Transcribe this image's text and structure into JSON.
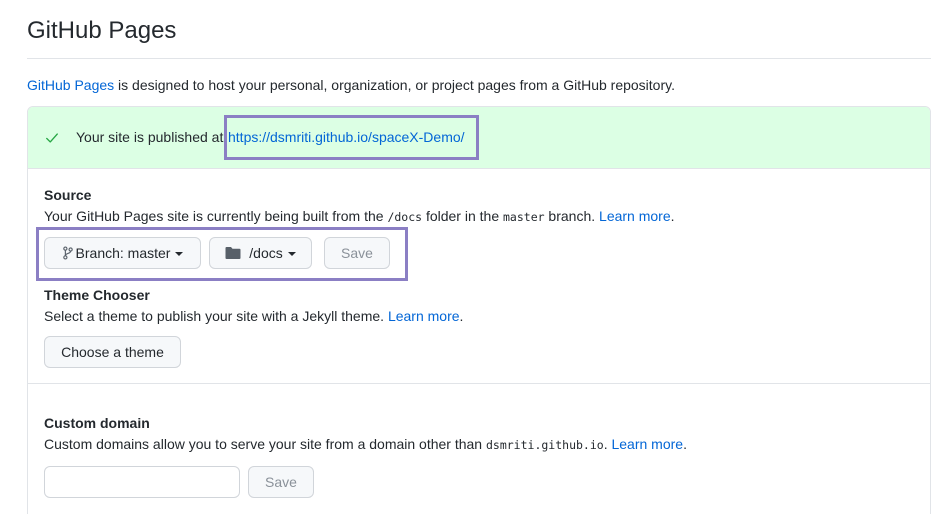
{
  "page": {
    "title": "GitHub Pages"
  },
  "intro": {
    "link_text": "GitHub Pages",
    "text": " is designed to host your personal, organization, or project pages from a GitHub repository."
  },
  "published": {
    "text": "Your site is published at ",
    "url": "https://dsmriti.github.io/spaceX-Demo/",
    "icon": "check-icon"
  },
  "source": {
    "heading": "Source",
    "desc_prefix": "Your GitHub Pages site is currently being built from the ",
    "folder_code": "/docs",
    "desc_middle": " folder in the ",
    "branch_code": "master",
    "desc_suffix": " branch. ",
    "learn_more": "Learn more",
    "desc_end": ".",
    "branch_button": "Branch: master",
    "folder_button": "/docs",
    "save_button": "Save"
  },
  "theme": {
    "heading": "Theme Chooser",
    "desc": "Select a theme to publish your site with a Jekyll theme. ",
    "learn_more": "Learn more",
    "desc_end": ".",
    "button": "Choose a theme"
  },
  "custom_domain": {
    "heading": "Custom domain",
    "desc": "Custom domains allow you to serve your site from a domain other than ",
    "domain_code": "dsmriti.github.io",
    "desc_middle": ". ",
    "learn_more": "Learn more",
    "desc_end": ".",
    "input_value": "",
    "save_button": "Save"
  },
  "colors": {
    "link": "#0366d6",
    "success_bg": "#dcffe4",
    "highlight": "#8b7fc4"
  }
}
